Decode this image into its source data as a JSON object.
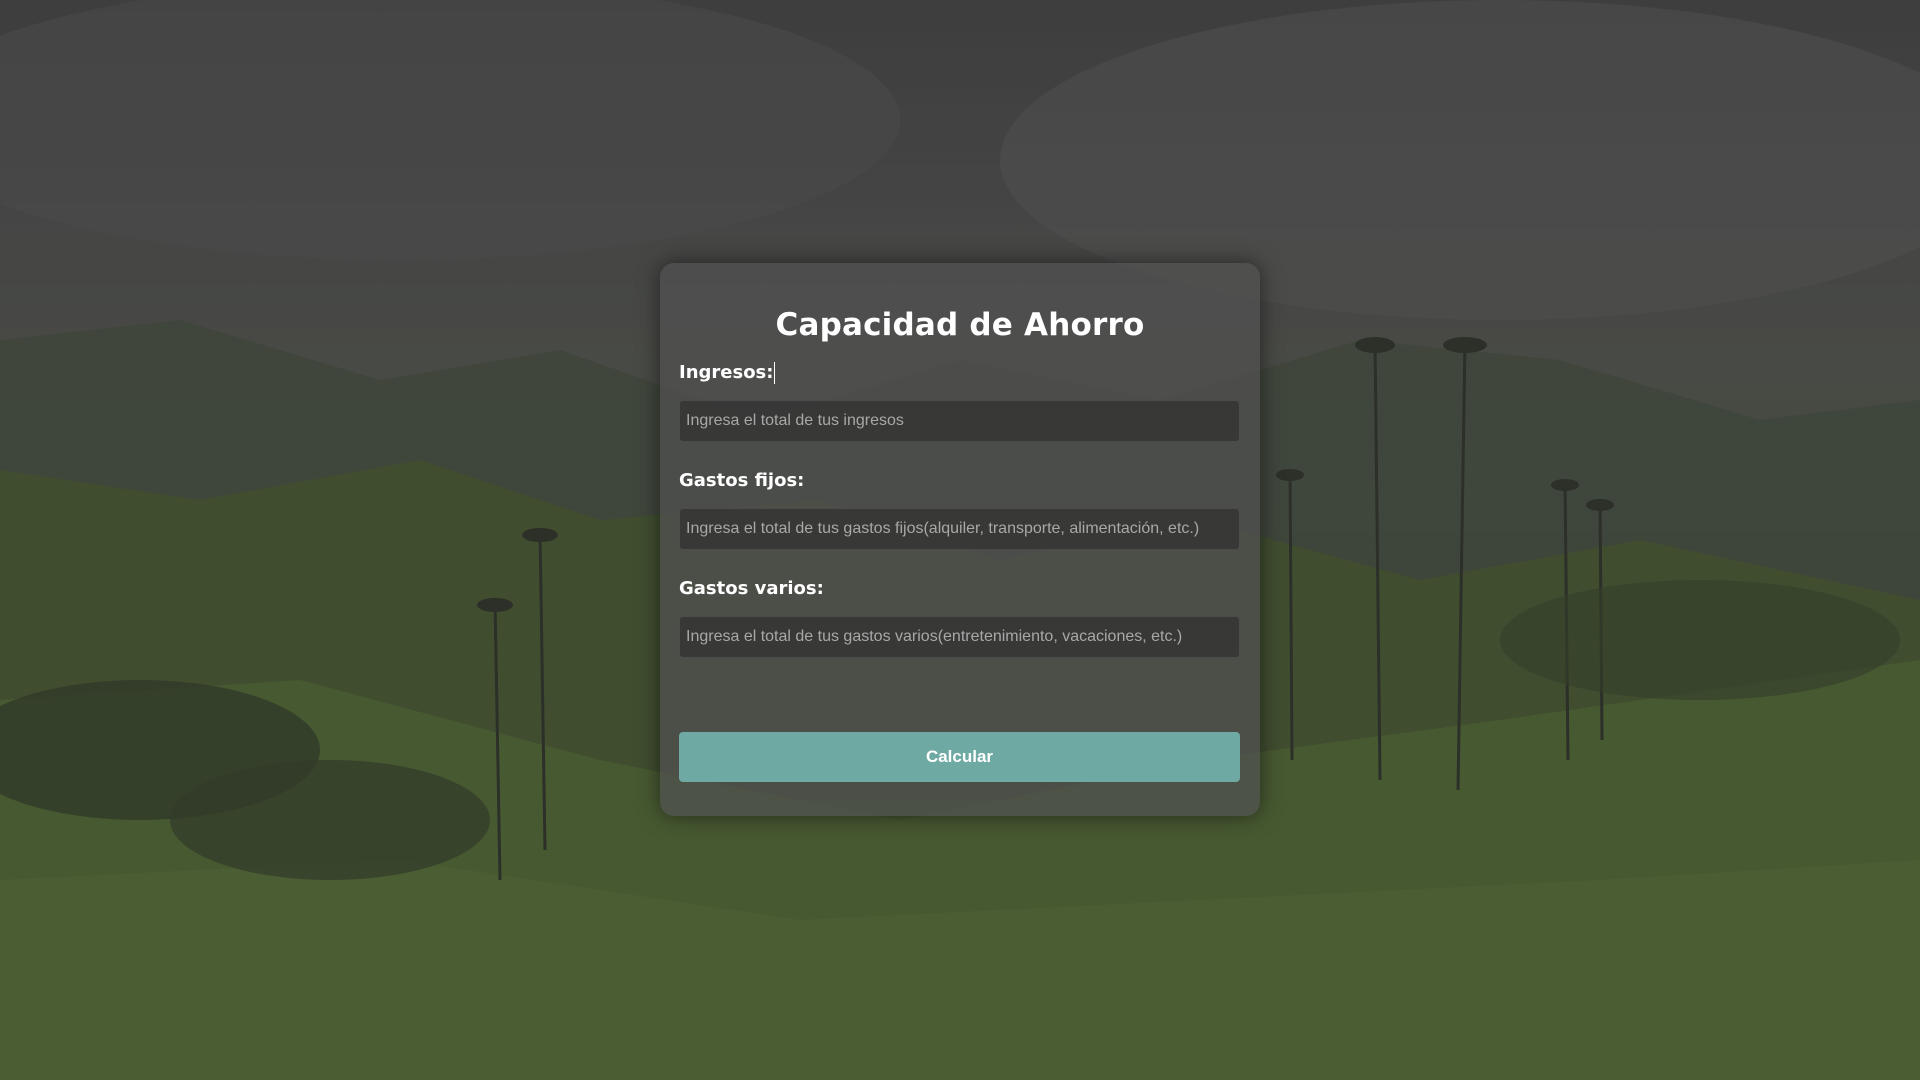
{
  "form": {
    "title": "Capacidad de Ahorro",
    "fields": [
      {
        "label": "Ingresos:",
        "placeholder": "Ingresa el total de tus ingresos",
        "value": ""
      },
      {
        "label": "Gastos fijos:",
        "placeholder": "Ingresa el total de tus gastos fijos(alquiler, transporte, alimentación, etc.)",
        "value": ""
      },
      {
        "label": "Gastos varios:",
        "placeholder": "Ingresa el total de tus gastos varios(entretenimiento, vacaciones, etc.)",
        "value": ""
      }
    ],
    "submit_label": "Calcular"
  },
  "colors": {
    "button": "#6fa9a3",
    "card": "#505050",
    "text": "#ffffff"
  }
}
